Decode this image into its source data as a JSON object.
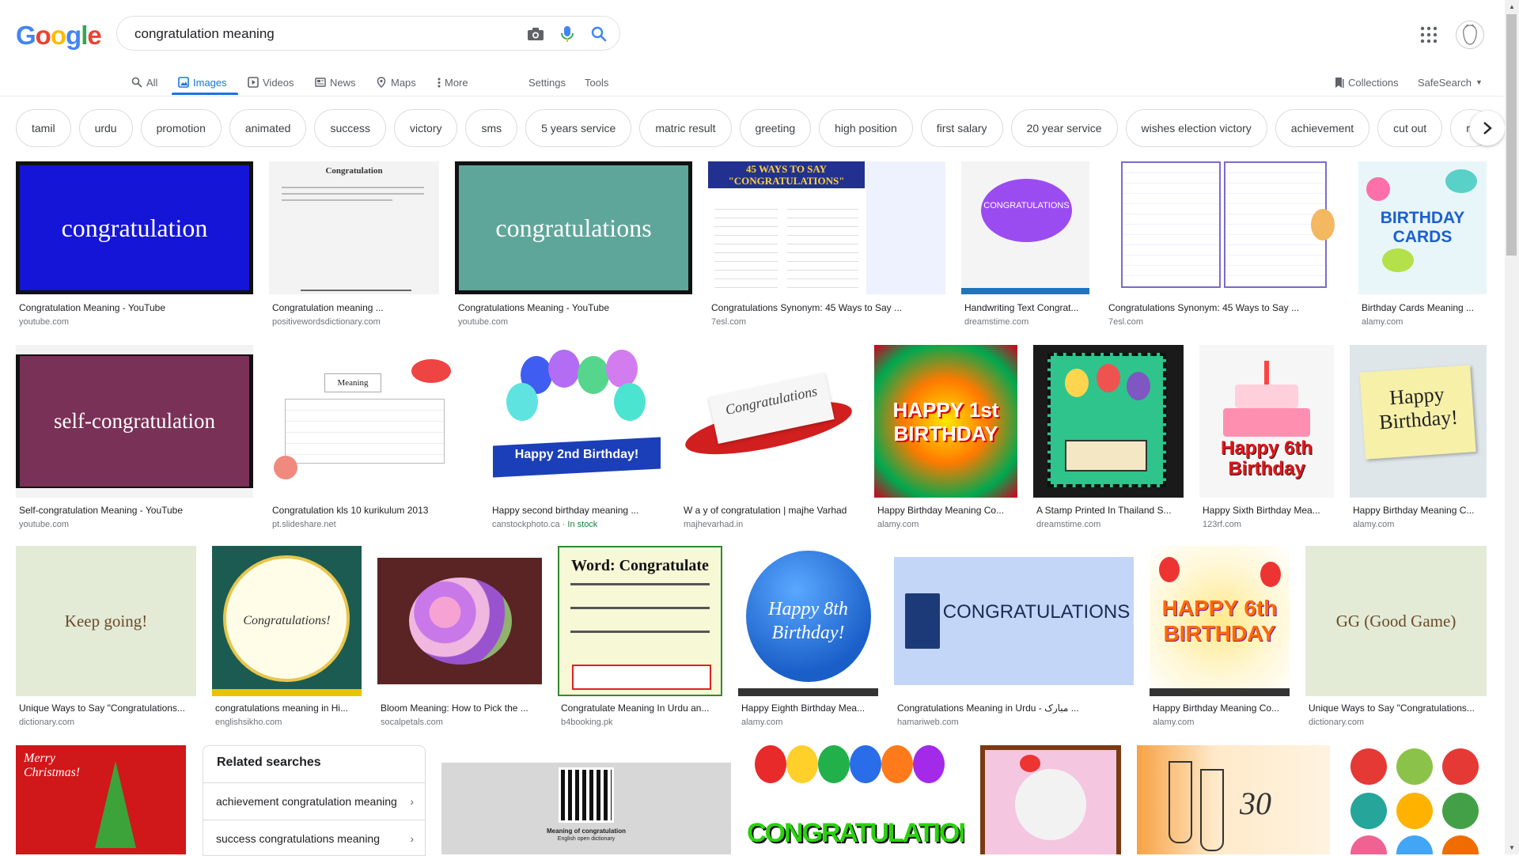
{
  "logo": {
    "G": "G",
    "o1": "o",
    "o2": "o",
    "g": "g",
    "l": "l",
    "e": "e"
  },
  "search": {
    "value": "congratulation meaning"
  },
  "nav": {
    "tabs": [
      {
        "label": "All"
      },
      {
        "label": "Images"
      },
      {
        "label": "Videos"
      },
      {
        "label": "News"
      },
      {
        "label": "Maps"
      },
      {
        "label": "More"
      }
    ],
    "settings": "Settings",
    "tools": "Tools",
    "collections": "Collections",
    "safesearch": "SafeSearch"
  },
  "chips": [
    "tamil",
    "urdu",
    "promotion",
    "animated",
    "success",
    "victory",
    "sms",
    "5 years service",
    "matric result",
    "greeting",
    "high position",
    "first salary",
    "20 year service",
    "wishes election victory",
    "achievement",
    "cut out",
    "re"
  ],
  "results": [
    {
      "caption": "Congratulation Meaning - YouTube",
      "source": "youtube.com",
      "text": "congratulation"
    },
    {
      "caption": "Congratulation meaning ...",
      "source": "positivewordsdictionary.com",
      "text": "Congratulation"
    },
    {
      "caption": "Congratulations Meaning - YouTube",
      "source": "youtube.com",
      "text": "congratulations"
    },
    {
      "caption": "Congratulations Synonym: 45 Ways to Say ...",
      "source": "7esl.com",
      "text": "45 WAYS TO SAY \"CONGRATULATIONS\""
    },
    {
      "caption": "Handwriting Text Congrat...",
      "source": "dreamstime.com",
      "text": "CONGRATULATIONS"
    },
    {
      "caption": "Congratulations Synonym: 45 Ways to Say ...",
      "source": "7esl.com",
      "text": ""
    },
    {
      "caption": "Birthday Cards Meaning ...",
      "source": "alamy.com",
      "text": "BIRTHDAY CARDS"
    },
    {
      "caption": "Self-congratulation Meaning - YouTube",
      "source": "youtube.com",
      "text": "self-congratulation"
    },
    {
      "caption": "Congratulation kls 10 kurikulum 2013",
      "source": "pt.slideshare.net",
      "text": "Meaning"
    },
    {
      "caption": "Happy second birthday meaning ...",
      "source": "canstockphoto.ca",
      "stock": "In stock",
      "text": "Happy 2nd Birthday!"
    },
    {
      "caption": "W a y of congratulation | majhe Varhad",
      "source": "majhevarhad.in",
      "text": "Congratulations"
    },
    {
      "caption": "Happy Birthday Meaning Co...",
      "source": "alamy.com",
      "text": "HAPPY 1st BIRTHDAY"
    },
    {
      "caption": "A Stamp Printed In Thailand S...",
      "source": "dreamstime.com",
      "text": ""
    },
    {
      "caption": "Happy Sixth Birthday Mea...",
      "source": "123rf.com",
      "text": "Happy 6th Birthday"
    },
    {
      "caption": "Happy Birthday Meaning C...",
      "source": "alamy.com",
      "text": "Happy Birthday!"
    },
    {
      "caption": "Unique Ways to Say \"Congratulations...",
      "source": "dictionary.com",
      "text": "Keep going!"
    },
    {
      "caption": "congratulations meaning in Hi...",
      "source": "englishsikho.com",
      "text": "Congratulations!"
    },
    {
      "caption": "Bloom Meaning: How to Pick the ...",
      "source": "socalpetals.com",
      "text": ""
    },
    {
      "caption": "Congratulate Meaning In Urdu an...",
      "source": "b4booking.pk",
      "text": "Word: Congratulate"
    },
    {
      "caption": "Happy Eighth Birthday Mea...",
      "source": "alamy.com",
      "text": "Happy 8th Birthday!"
    },
    {
      "caption": "Congratulations Meaning in Urdu - مبارک ...",
      "source": "hamariweb.com",
      "text": "CONGRATULATIONS"
    },
    {
      "caption": "Happy Birthday Meaning Co...",
      "source": "alamy.com",
      "text": "HAPPY 6th BIRTHDAY"
    },
    {
      "caption": "Unique Ways to Say \"Congratulations...",
      "source": "dictionary.com",
      "text": "GG (Good Game)"
    }
  ],
  "related": {
    "title": "Related searches",
    "items": [
      "achievement congratulation meaning",
      "success congratulations meaning"
    ]
  },
  "bottom_images": {
    "merry": "Merry Christmas!",
    "qr_caption": "Meaning of congratulation",
    "qr_sub": "English open dictionary",
    "congrats": "CONGRATULATIONS"
  }
}
